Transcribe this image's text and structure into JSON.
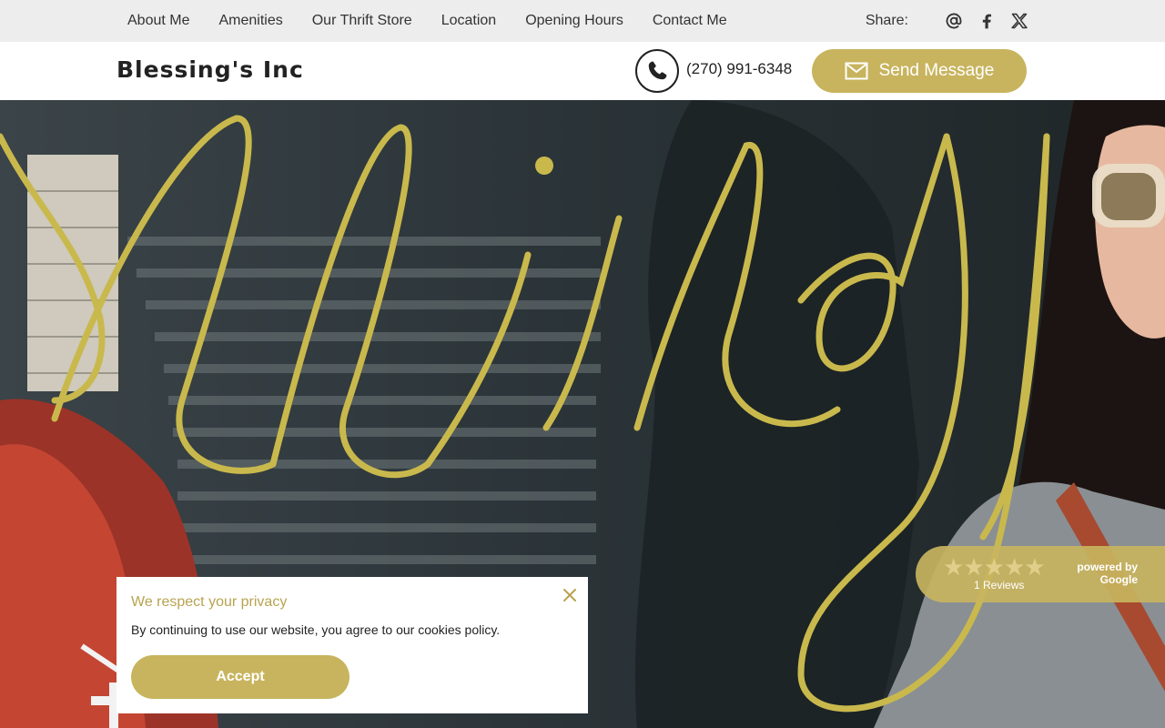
{
  "nav": {
    "items": [
      "About Me",
      "Amenities",
      "Our Thrift Store",
      "Location",
      "Opening Hours",
      "Contact Me"
    ],
    "share_label": "Share:",
    "share_icons": [
      "at-icon",
      "facebook-icon",
      "x-twitter-icon"
    ]
  },
  "header": {
    "brand": "Blessing's Inc",
    "phone": "(270) 991-6348",
    "send_label": "Send Message"
  },
  "reviews": {
    "stars": 5,
    "count_label": "1 Reviews",
    "powered_line1": "powered by",
    "powered_line2": "Google"
  },
  "cookie": {
    "title": "We respect your privacy",
    "message": "By continuing to use our website, you agree to our cookies policy.",
    "accept_label": "Accept"
  },
  "colors": {
    "accent": "#c8b45e",
    "nav_bg": "#ededed"
  }
}
